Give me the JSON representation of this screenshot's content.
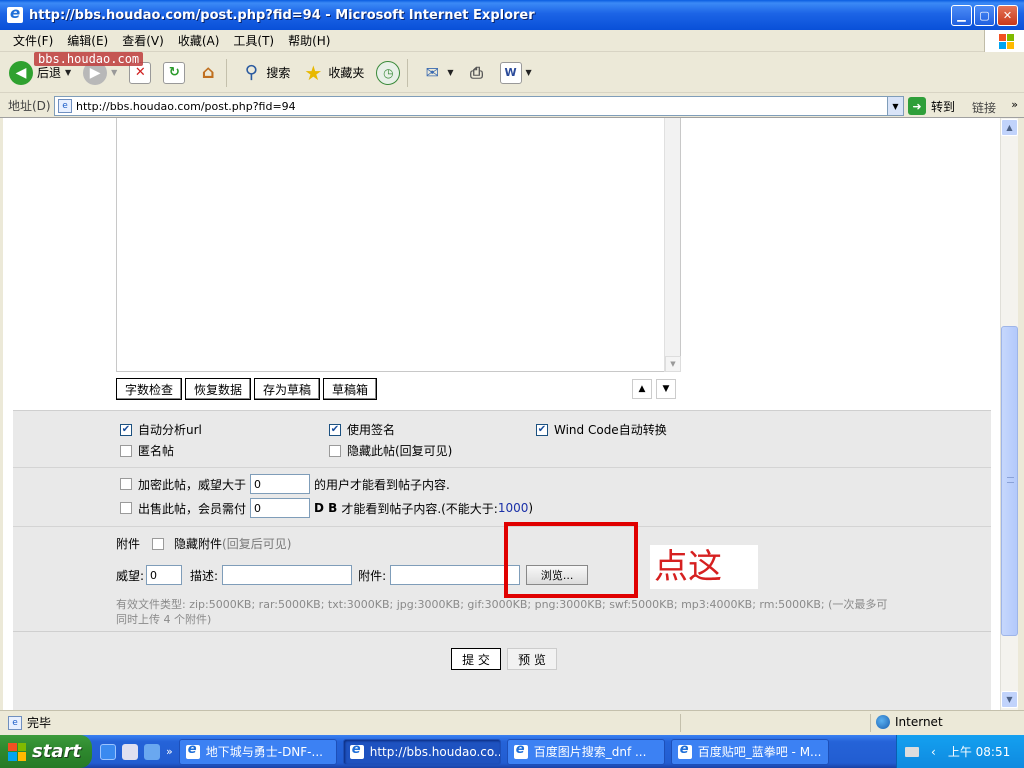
{
  "window": {
    "title": "http://bbs.houdao.com/post.php?fid=94 - Microsoft Internet Explorer"
  },
  "menu": [
    "文件(F)",
    "编辑(E)",
    "查看(V)",
    "收藏(A)",
    "工具(T)",
    "帮助(H)"
  ],
  "watermark": "bbs.houdao.com",
  "toolbar": {
    "back": "后退",
    "search": "搜索",
    "favorites": "收藏夹"
  },
  "address": {
    "label": "地址(D)",
    "url": "http://bbs.houdao.com/post.php?fid=94",
    "go": "转到",
    "links": "链接"
  },
  "editor_buttons": [
    "字数检查",
    "恢复数据",
    "存为草稿",
    "草稿箱"
  ],
  "options": {
    "auto_url": {
      "label": "自动分析url",
      "checked": true
    },
    "use_signature": {
      "label": "使用签名",
      "checked": true
    },
    "wind_code": {
      "label": "Wind Code自动转换",
      "checked": true
    },
    "anonymous": {
      "label": "匿名帖",
      "checked": false
    },
    "hide_post": {
      "label": "隐藏此帖(回复可见)",
      "checked": false
    },
    "encrypt": {
      "label_prefix": "加密此帖，威望大于",
      "value": "0",
      "label_suffix": "的用户才能看到帖子内容."
    },
    "sell": {
      "label_prefix": "出售此帖，会员需付",
      "value": "0",
      "currency": "D B",
      "label_suffix": "才能看到帖子内容.(不能大于:",
      "max": "1000",
      "close": ")"
    }
  },
  "attachment": {
    "label": "附件",
    "hide_label": "隐藏附件",
    "hide_hint": "(回复后可见)",
    "prestige_label": "威望:",
    "prestige_value": "0",
    "desc_label": "描述:",
    "file_label": "附件:",
    "browse": "浏览...",
    "filetypes": "有效文件类型: zip:5000KB; rar:5000KB; txt:3000KB; jpg:3000KB; gif:3000KB; png:3000KB; swf:5000KB; mp3:4000KB; rm:5000KB; (一次最多可同时上传 4 个附件)"
  },
  "submit": {
    "submit": "提 交",
    "preview": "预 览"
  },
  "annotation": {
    "hint": "点这",
    "color": "#e00000"
  },
  "status": {
    "text": "完毕",
    "zone": "Internet"
  },
  "taskbar": {
    "start": "start",
    "tasks": [
      {
        "label": "地下城与勇士-DNF-...",
        "active": false
      },
      {
        "label": "http://bbs.houdao.co...",
        "active": true
      },
      {
        "label": "百度图片搜索_dnf ...",
        "active": false
      },
      {
        "label": "百度贴吧_蓝拳吧 - M...",
        "active": false
      }
    ],
    "clock": "上午 08:51"
  }
}
